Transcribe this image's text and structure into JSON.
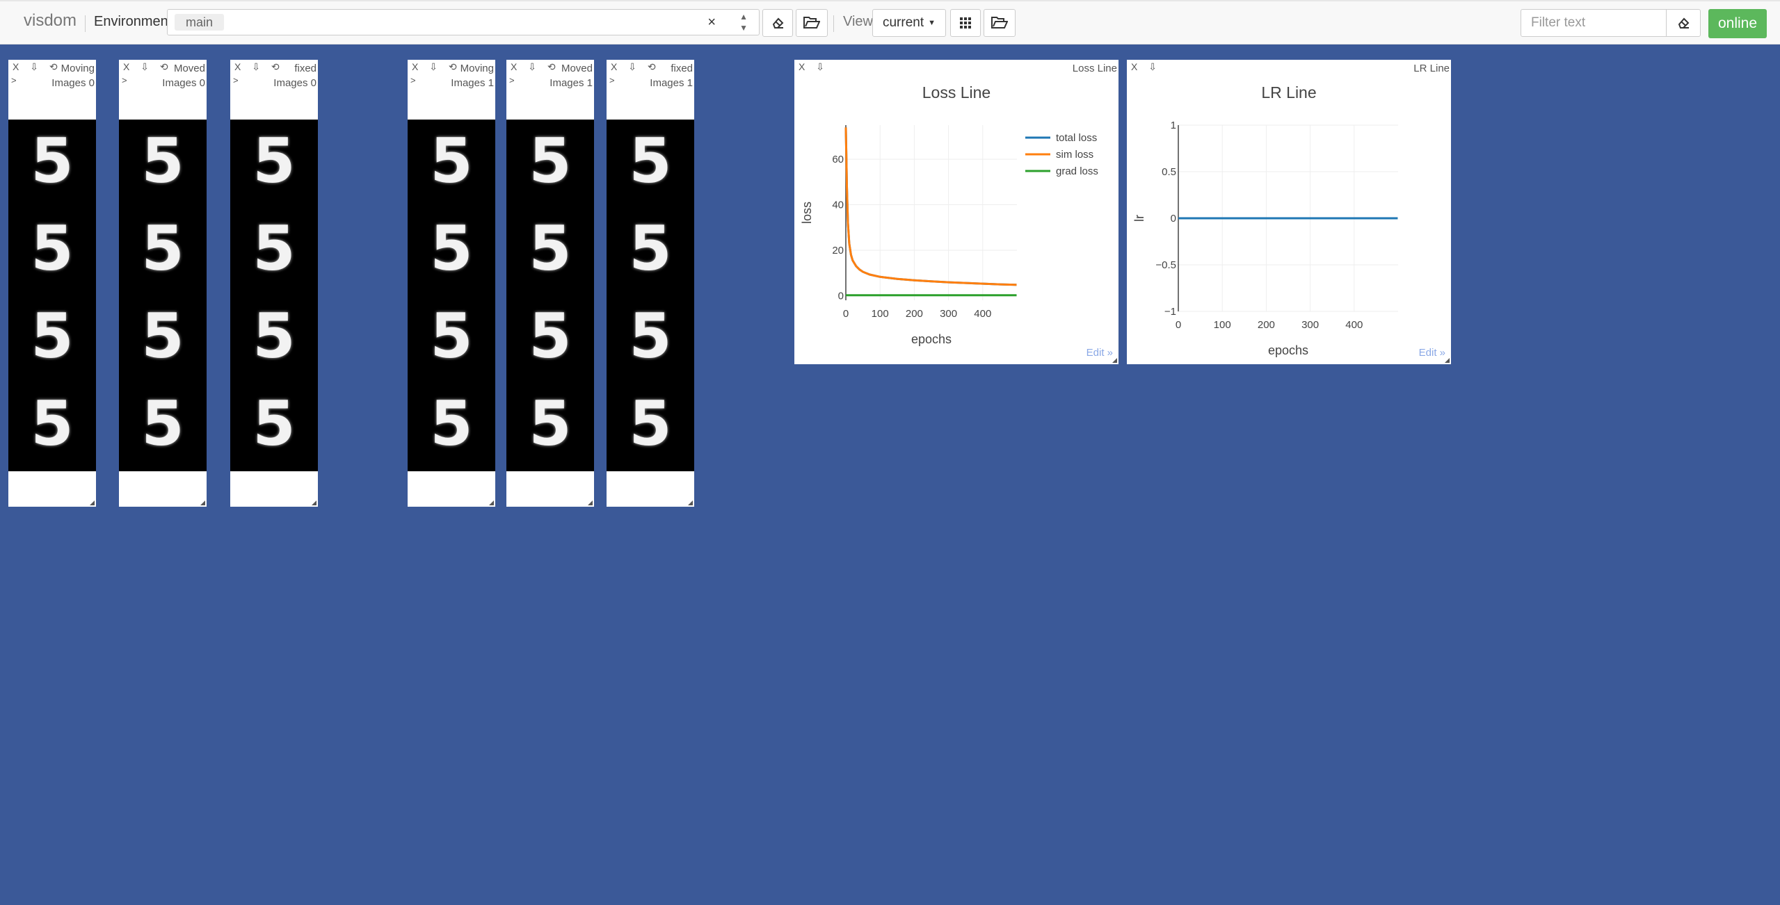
{
  "topbar": {
    "brand": "visdom",
    "env_label": "Environment",
    "env_value": "main",
    "env_clear": "×",
    "view_label": "View",
    "view_value": "current",
    "filter_placeholder": "Filter text",
    "online_label": "online"
  },
  "image_panes": [
    {
      "title": "Moving\nImages 0",
      "digits": [
        "5",
        "5",
        "5",
        "5"
      ]
    },
    {
      "title": "Moved\nImages 0",
      "digits": [
        "5",
        "5",
        "5",
        "5"
      ]
    },
    {
      "title": "fixed\nImages 0",
      "digits": [
        "5",
        "5",
        "5",
        "5"
      ]
    },
    {
      "title": "Moving\nImages 1",
      "digits": [
        "5",
        "5",
        "5",
        "5"
      ]
    },
    {
      "title": "Moved\nImages 1",
      "digits": [
        "5",
        "5",
        "5",
        "5"
      ]
    },
    {
      "title": "fixed\nImages 1",
      "digits": [
        "5",
        "5",
        "5",
        "5"
      ]
    }
  ],
  "pane_buttons": "X ⇩ ⟲",
  "pane_arrow": ">",
  "chart_data": [
    {
      "type": "line",
      "pane_title": "Loss Line",
      "title": "Loss Line",
      "xlabel": "epochs",
      "ylabel": "loss",
      "xlim": [
        0,
        500
      ],
      "ylim": [
        -2,
        75
      ],
      "xticks": [
        0,
        100,
        200,
        300,
        400
      ],
      "yticks": [
        0,
        20,
        40,
        60
      ],
      "legend": "top-right",
      "grid": true,
      "x": [
        0,
        3,
        6,
        10,
        15,
        20,
        30,
        40,
        50,
        70,
        100,
        150,
        200,
        250,
        300,
        350,
        400,
        450,
        499
      ],
      "series": [
        {
          "name": "total loss",
          "color": "#1f77b4",
          "values": [
            74,
            48,
            32,
            23,
            18,
            15.5,
            13,
            11.5,
            10.5,
            9.3,
            8.3,
            7.4,
            6.8,
            6.3,
            5.9,
            5.6,
            5.3,
            5.0,
            4.8
          ]
        },
        {
          "name": "sim loss",
          "color": "#ff7f0e",
          "values": [
            74,
            48,
            32,
            23,
            18,
            15.5,
            13,
            11.5,
            10.5,
            9.3,
            8.3,
            7.4,
            6.8,
            6.3,
            5.9,
            5.6,
            5.3,
            5.0,
            4.8
          ]
        },
        {
          "name": "grad loss",
          "color": "#2ca02c",
          "values": [
            0.2,
            0.2,
            0.2,
            0.2,
            0.2,
            0.2,
            0.2,
            0.2,
            0.2,
            0.2,
            0.2,
            0.2,
            0.2,
            0.2,
            0.2,
            0.2,
            0.2,
            0.2,
            0.2
          ]
        }
      ]
    },
    {
      "type": "line",
      "pane_title": "LR Line",
      "title": "LR Line",
      "xlabel": "epochs",
      "ylabel": "lr",
      "xlim": [
        0,
        500
      ],
      "ylim": [
        -1,
        1
      ],
      "xticks": [
        0,
        100,
        200,
        300,
        400
      ],
      "yticks": [
        1,
        0.5,
        0,
        -0.5,
        -1
      ],
      "ytick_labels": [
        "1",
        "0.5",
        "0",
        "−0.5",
        "−1"
      ],
      "grid": true,
      "x": [
        0,
        499
      ],
      "series": [
        {
          "color": "#1f77b4",
          "values": [
            0,
            0
          ]
        }
      ]
    }
  ],
  "edit_label": "Edit »"
}
